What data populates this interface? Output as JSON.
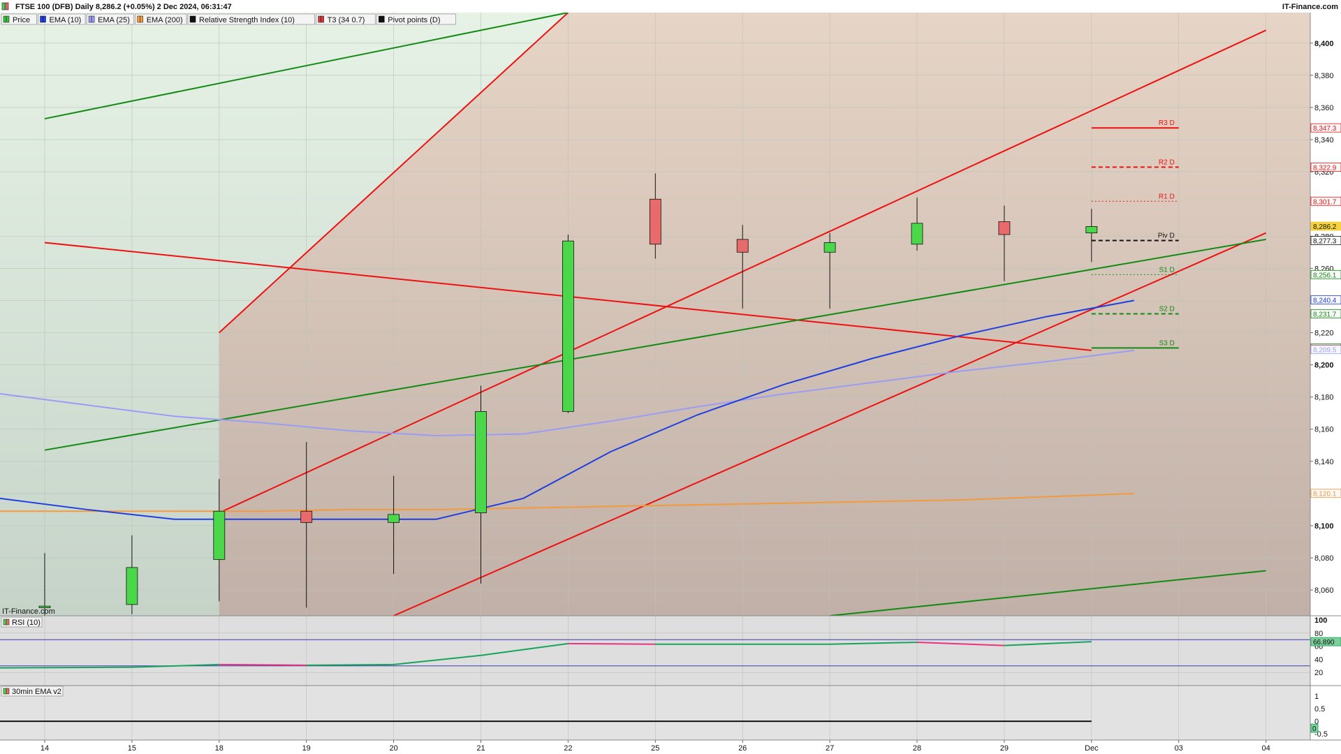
{
  "header": {
    "title": "FTSE 100 (DFB) Daily 8,286.2 (+0.05%) 2 Dec 2024, 06:31:47",
    "brand": "IT-Finance.com",
    "legend": [
      {
        "label": "Price",
        "color": "#3fbf3f",
        "icon": "candle-swatch-icon"
      },
      {
        "label": "EMA (10)",
        "color": "#1f3fe0",
        "icon": "line-swatch-icon"
      },
      {
        "label": "EMA (25)",
        "color": "#9a9cf5",
        "icon": "line-swatch-icon"
      },
      {
        "label": "EMA (200)",
        "color": "#f39a3c",
        "icon": "line-swatch-icon"
      },
      {
        "label": "Relative Strength Index (10)",
        "color": "#111111",
        "icon": "line-swatch-icon"
      },
      {
        "label": "T3 (34 0.7)",
        "color": "#d33a3a",
        "icon": "line-swatch-icon"
      },
      {
        "label": "Pivot points (D)",
        "color": "#111111",
        "icon": "line-swatch-icon"
      }
    ]
  },
  "watermark": "IT-Finance.com",
  "rsi_panel_label": "RSI (10)",
  "ema_panel_label": "30min EMA v2",
  "colors": {
    "up": "#4ad84a",
    "down": "#e86a6a",
    "ema10": "#1f3fe0",
    "ema25": "#9a9cf5",
    "ema200": "#f39a3c",
    "channel_red": "#ee1111",
    "channel_green": "#138a13",
    "price_tag": "#f5d33a"
  },
  "chart_data": {
    "type": "candlestick",
    "x_labels": [
      "14",
      "15",
      "18",
      "19",
      "20",
      "21",
      "22",
      "25",
      "26",
      "27",
      "28",
      "29",
      "Dec",
      "03",
      "04"
    ],
    "y_ticks": [
      "8,060",
      "8,080",
      "8,100",
      "8,120",
      "8,140",
      "8,160",
      "8,180",
      "8,200",
      "8,220",
      "8,240",
      "8,260",
      "8,280",
      "8,320",
      "8,340",
      "8,360",
      "8,380",
      "8,400"
    ],
    "ylim": [
      8044,
      8419
    ],
    "candles": [
      {
        "date": "14",
        "open": 8049,
        "high": 8083,
        "low": 8044,
        "close": 8050
      },
      {
        "date": "15",
        "open": 8051,
        "high": 8094,
        "low": 8045,
        "close": 8074
      },
      {
        "date": "18",
        "open": 8079,
        "high": 8129,
        "low": 8053,
        "close": 8109
      },
      {
        "date": "19",
        "open": 8109,
        "high": 8152,
        "low": 8049,
        "close": 8102
      },
      {
        "date": "20",
        "open": 8102,
        "high": 8131,
        "low": 8070,
        "close": 8107
      },
      {
        "date": "21",
        "open": 8108,
        "high": 8187,
        "low": 8064,
        "close": 8171
      },
      {
        "date": "22",
        "open": 8171,
        "high": 8281,
        "low": 8170,
        "close": 8277
      },
      {
        "date": "25",
        "open": 8303,
        "high": 8319,
        "low": 8266,
        "close": 8275
      },
      {
        "date": "26",
        "open": 8278,
        "high": 8287,
        "low": 8235,
        "close": 8270
      },
      {
        "date": "27",
        "open": 8270,
        "high": 8282,
        "low": 8235,
        "close": 8276
      },
      {
        "date": "28",
        "open": 8275,
        "high": 8304,
        "low": 8271,
        "close": 8288
      },
      {
        "date": "29",
        "open": 8289,
        "high": 8299,
        "low": 8252,
        "close": 8281
      },
      {
        "date": "Dec",
        "open": 8282,
        "high": 8297,
        "low": 8264,
        "close": 8286
      }
    ],
    "ema10": [
      8117,
      8110,
      8104,
      8104,
      8104,
      8104,
      8117,
      8146,
      8169,
      8188,
      8204,
      8218,
      8230,
      8240
    ],
    "ema25": [
      8182,
      8175,
      8168,
      8164,
      8159,
      8156,
      8157,
      8165,
      8174,
      8182,
      8189,
      8196,
      8202,
      8209
    ],
    "ema200": [
      8109,
      8109,
      8109,
      8109,
      8110,
      8110,
      8111,
      8112,
      8113,
      8114,
      8115,
      8116,
      8118,
      8120
    ],
    "pivots": [
      {
        "label": "R3 D",
        "value": 8347.3,
        "value_label": "8,347.3",
        "style": "solid",
        "color": "#ee1111"
      },
      {
        "label": "R2 D",
        "value": 8322.9,
        "value_label": "8,322.9",
        "style": "dashed",
        "color": "#ee1111"
      },
      {
        "label": "R1 D",
        "value": 8301.7,
        "value_label": "8,301.7",
        "style": "dotted",
        "color": "#ee1111"
      },
      {
        "label": "Piv D",
        "value": 8277.3,
        "value_label": "8,277.3",
        "style": "dashed",
        "color": "#111111"
      },
      {
        "label": "S1 D",
        "value": 8256.1,
        "value_label": "8,256.1",
        "style": "dotted",
        "color": "#138a13"
      },
      {
        "label": "S2 D",
        "value": 8231.7,
        "value_label": "8,231.7",
        "style": "dashed",
        "color": "#138a13"
      },
      {
        "label": "S3 D",
        "value": 8210.5,
        "value_label": "8,210.5",
        "style": "solid",
        "color": "#138a13"
      }
    ],
    "price_labels": [
      {
        "value": 8286.2,
        "label": "8,286.2",
        "color": "#f5d33a"
      },
      {
        "value": 8240.4,
        "label": "8,240.4",
        "color": "#1f3fe0"
      },
      {
        "value": 8120.1,
        "label": "8,120.1",
        "color": "#f39a3c"
      },
      {
        "value": 8209.7,
        "label": "8,209.7",
        "color": "#ee1111"
      },
      {
        "value": 8209.5,
        "label": "8,209.5",
        "color": "#9a9cf5"
      }
    ],
    "trendlines": [
      {
        "color": "#ee1111",
        "start": {
          "date": "18",
          "value": 8220
        },
        "end": {
          "date": "22",
          "value": 8419
        }
      },
      {
        "color": "#ee1111",
        "start": {
          "date": "18",
          "value": 8108
        },
        "end": {
          "date": "04",
          "value": 8408
        }
      },
      {
        "color": "#ee1111",
        "start": {
          "date": "20",
          "value": 8044
        },
        "end": {
          "date": "04",
          "value": 8282
        }
      },
      {
        "color": "#ee1111",
        "start": {
          "date": "14",
          "value": 8276
        },
        "end": {
          "date": "Dec",
          "value": 8209
        }
      },
      {
        "color": "#138a13",
        "start": {
          "date": "14",
          "value": 8353
        },
        "end": {
          "date": "22",
          "value": 8419
        }
      },
      {
        "color": "#138a13",
        "start": {
          "date": "14",
          "value": 8147
        },
        "end": {
          "date": "04",
          "value": 8278
        }
      },
      {
        "color": "#138a13",
        "start": {
          "date": "27",
          "value": 8044
        },
        "end": {
          "date": "04",
          "value": 8072
        }
      }
    ],
    "rsi": {
      "label": "RSI (10)",
      "ticks": [
        "100",
        "80",
        "60",
        "40",
        "20"
      ],
      "ylim": [
        0,
        100
      ],
      "levels": [
        70,
        30
      ],
      "values": [
        27,
        28,
        32,
        31,
        32,
        46,
        64,
        63,
        63,
        63,
        66,
        61,
        66.89
      ],
      "last_label": "66.890"
    },
    "ema_panel": {
      "label": "30min EMA v2",
      "ticks": [
        "1",
        "0.5",
        "0",
        "-0.5"
      ],
      "ylim": [
        -0.75,
        1.2
      ],
      "value": 0,
      "last_label": "0"
    }
  }
}
